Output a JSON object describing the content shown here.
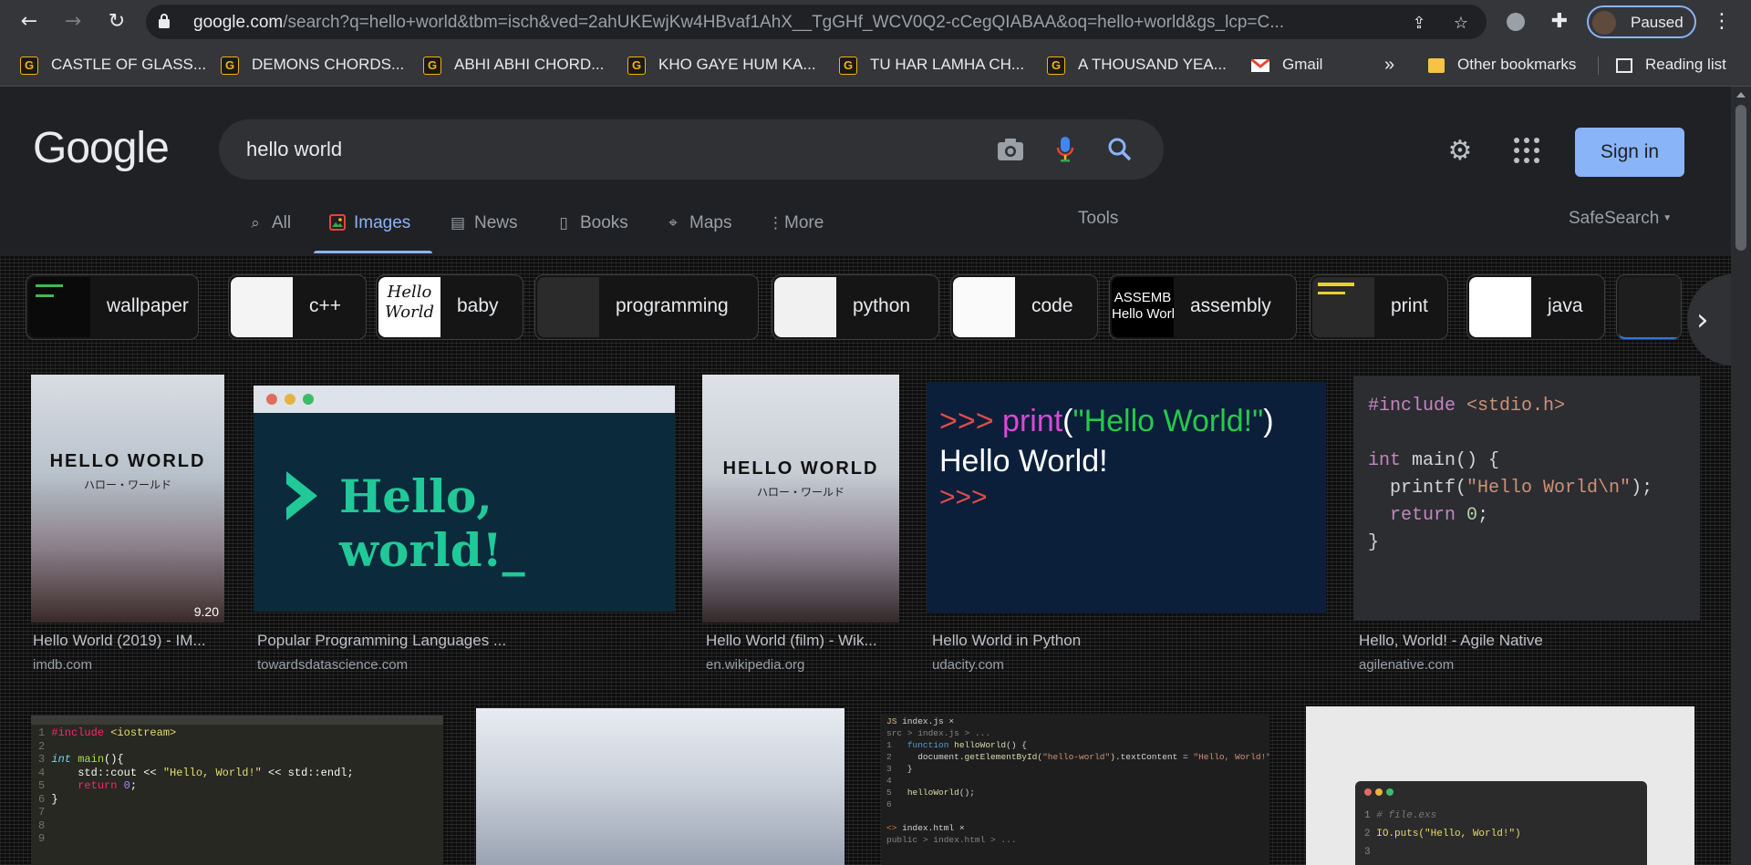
{
  "browser": {
    "url_domain": "google.com",
    "url_rest": "/search?q=hello+world&tbm=isch&ved=2ahUKEwjKw4HBvaf1AhX__TgGHf_WCV0Q2-cCegQIABAA&oq=hello+world&gs_lcp=C...",
    "profile_status": "Paused"
  },
  "bookmarks": [
    {
      "label": "CASTLE OF GLASS..."
    },
    {
      "label": "DEMONS CHORDS..."
    },
    {
      "label": "ABHI ABHI CHORD..."
    },
    {
      "label": "KHO GAYE HUM KA..."
    },
    {
      "label": "TU HAR LAMHA CH..."
    },
    {
      "label": "A THOUSAND YEA..."
    },
    {
      "label": "Gmail"
    }
  ],
  "bookmarks_overflow": "»",
  "other_bookmarks": "Other bookmarks",
  "reading_list": "Reading list",
  "search": {
    "logo": "Google",
    "query": "hello world",
    "sign_in": "Sign in"
  },
  "tabs": [
    {
      "label": "All",
      "icon": "search-icon"
    },
    {
      "label": "Images",
      "icon": "image-icon",
      "active": true
    },
    {
      "label": "News",
      "icon": "news-icon"
    },
    {
      "label": "Books",
      "icon": "book-icon"
    },
    {
      "label": "Maps",
      "icon": "map-pin-icon"
    },
    {
      "label": "More",
      "icon": "more-vert-icon"
    }
  ],
  "tools": "Tools",
  "safesearch": "SafeSearch",
  "chips": [
    "wallpaper",
    "c++",
    "baby",
    "programming",
    "python",
    "code",
    "assembly",
    "print",
    "java"
  ],
  "chip_thumb_text": {
    "baby": "Hello World",
    "assembly": "ASSEMB\nHello World"
  },
  "results": [
    {
      "caption": "Hello World (2019) - IM...",
      "source": "imdb.com",
      "poster_title": "HELLO WORLD",
      "poster_sub": "ハロー・ワールド",
      "badge": "9.20"
    },
    {
      "caption": "Popular Programming Languages ...",
      "source": "towardsdatascience.com",
      "image_text": "Hello, world!_"
    },
    {
      "caption": "Hello World (film) - Wik...",
      "source": "en.wikipedia.org",
      "poster_title": "HELLO WORLD",
      "poster_sub": "ハロー・ワールド"
    },
    {
      "caption": "Hello World in Python",
      "source": "udacity.com",
      "line1_prompt": ">>>",
      "line1_fn": "print",
      "line1_paren_open": "(",
      "line1_str": "\"Hello World!\"",
      "line1_paren_close": ")",
      "line2": "Hello World!",
      "line3": ">>>"
    },
    {
      "caption": "Hello, World! - Agile Native",
      "source": "agilenative.com"
    }
  ],
  "row2": {
    "cpp_lines": [
      "1",
      "2",
      "3",
      "4",
      "5",
      "6",
      "7",
      "8",
      "9"
    ],
    "js_tab1": "index.js",
    "js_tab2": "index.html",
    "js_breadcrumb": "src > index.js > ...",
    "js_line1": "function helloWorld() {",
    "js_line2": "document.getElementById(\"hello-world\").textContent = \"Hello, World!\";",
    "js_line3": "}",
    "js_line5": "helloWorld();",
    "js_footer": "public > index.html > ...",
    "ex_line1": "# file.exs",
    "ex_line2": "IO.puts(\"Hello, World!\")"
  }
}
